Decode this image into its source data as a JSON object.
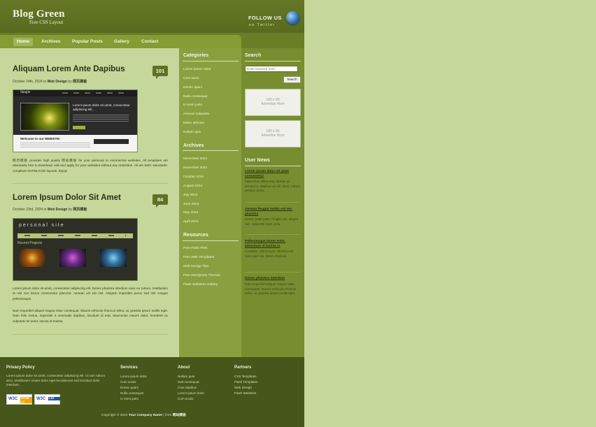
{
  "header": {
    "logo_title": "Blog Green",
    "logo_sub": "Free CSS Layout",
    "follow_label": "FOLLOW US",
    "follow_sub": "on Twitter"
  },
  "nav": {
    "items": [
      "Home",
      "Archives",
      "Popular Posts",
      "Gallery",
      "Contact"
    ],
    "active": "Home"
  },
  "posts": [
    {
      "title": "Aliquam Lorem Ante Dapibus",
      "date": "October 24th, 2024",
      "in": "in",
      "category": "Web Design",
      "by": "by",
      "author": "网页模板",
      "comments": "101",
      "thumb": {
        "brand": "Simple",
        "headline": "Lorem ipsum dolor sit amet, consectetur adipiscing elit.",
        "welcome": "Welcome to our WEBSITE!"
      },
      "paragraphs": [
        "网页模板 provides high quality 网站模板 for your personal or commercial websites. All templates are absolutely free to download, edit and apply for your websites without any restriction. All are W3C standards-compliant XHTML/CSS layouts. Enjoy!"
      ]
    },
    {
      "title": "Lorem Ipsum Dolor Sit Amet",
      "date": "October 23rd, 2024",
      "in": "in",
      "category": "Web Design",
      "by": "by",
      "author": "网页模板",
      "comments": "84",
      "thumb": {
        "brand": "personal site",
        "section": "Recent Projects"
      },
      "paragraphs": [
        "Lorem ipsum dolor sit amet, consectetur adipiscing elit. Donec pharetra interdum nunc eu rutrum. Vestibulum et nisl non lectus consectetur placerat. Aenean vel est nisl. Aliquam imperdiet purus sed nisl congue pellentesque.",
        "Nam imperdiet aliquet magna vitae consequat. Mauris vehicula rhoncus tellus, ac gravida ipsum mollis eget. Nam felis metus, imperdiet a venenatis dapibus, tincidunt id erat. Maecenas mauris dolor, hendrerit ac vulputate sit amet, lacinia id massa."
      ]
    }
  ],
  "categories": {
    "title": "Categories",
    "items": [
      "Lorem ipsum dolor",
      "Cum socis",
      "Donec quam",
      "Nulla consequat",
      "In enim justo",
      "Aenean vulputate",
      "Etiam ultricies",
      "Nullam quis"
    ]
  },
  "archives": {
    "title": "Archives",
    "items": [
      "December 2024",
      "November 2024",
      "October 2024",
      "August 2024",
      "July 2024",
      "June 2024",
      "May 2024",
      "April 2024"
    ]
  },
  "resources": {
    "title": "Resources",
    "items": [
      "Free Flash Files",
      "Free Web Templates",
      "Web Design Tips",
      "Free Wordpress Themes",
      "Flash Websites Gallery"
    ]
  },
  "search": {
    "title": "Search",
    "placeholder": "Enter keyword here...",
    "button": "Search"
  },
  "ads": [
    {
      "size": "180 x 90",
      "label": "Advertise Here"
    },
    {
      "size": "180 x 90",
      "label": "Advertise Here"
    }
  ],
  "user_news": {
    "title": "User News",
    "items": [
      {
        "title": "Lorem ipsum dolor sit amet consectetur",
        "text": "Maecenas tellus erat, dictum ac semper a, dapibus ac elit. Nunc rutrum pretium porta."
      },
      {
        "title": "Aenean feugiat mattis est nec pharetra",
        "text": "Donec pede justo, fringilla vel, aliquet nec, vulputate eget, arcu."
      },
      {
        "title": "Pellentesque lorem enim, bibendum id lacinia in",
        "text": "Curabitur ullamcorper ultricies nisi. Nam eget dui. Etiam rhoncus."
      },
      {
        "title": "Donec pharetra interdum",
        "text": "Nam imperdiet aliquet magna vitae consequat. Mauris vehicula rhoncus tellus, ac gravida ipsum mollis eget."
      }
    ]
  },
  "footer": {
    "privacy": {
      "title": "Privacy Policy",
      "text": "Lorem ipsum dolor sit amet, consectetur adipiscing elit. Ut non rutrum arcu. Vestibulum ornare dolor eget leo placerat sed tincidunt dolor interdum."
    },
    "services": {
      "title": "Services",
      "items": [
        "Lorem ipsum dolor",
        "Cum sociis",
        "Donec quam",
        "Nulla consequat",
        "In enim justo"
      ]
    },
    "about": {
      "title": "About",
      "items": [
        "Nullam quis",
        "Sed consequat",
        "Cras dapibus",
        "Lorem ipsum dolor",
        "Cum sociis"
      ]
    },
    "partners": {
      "title": "Partners",
      "items": [
        "CSS Templates",
        "Flash Templates",
        "Web Design",
        "Flash Websites"
      ]
    },
    "badges": [
      {
        "label": "W3C",
        "sub": "XHTML 1.0"
      },
      {
        "label": "W3C",
        "sub": "CSS"
      }
    ],
    "copyright_prefix": "Copyright © 2024",
    "company": "Your Company Name",
    "from_label": "| from",
    "from_name": "网站模板"
  },
  "colors": {
    "header_bg": "#667826",
    "nav_bg": "#849c31",
    "content_bg": "#c6d79c",
    "categories_bg": "#8aa040",
    "right_col_bg": "#778d30",
    "footer_bg": "#47561a",
    "accent_text": "#2b3210"
  }
}
